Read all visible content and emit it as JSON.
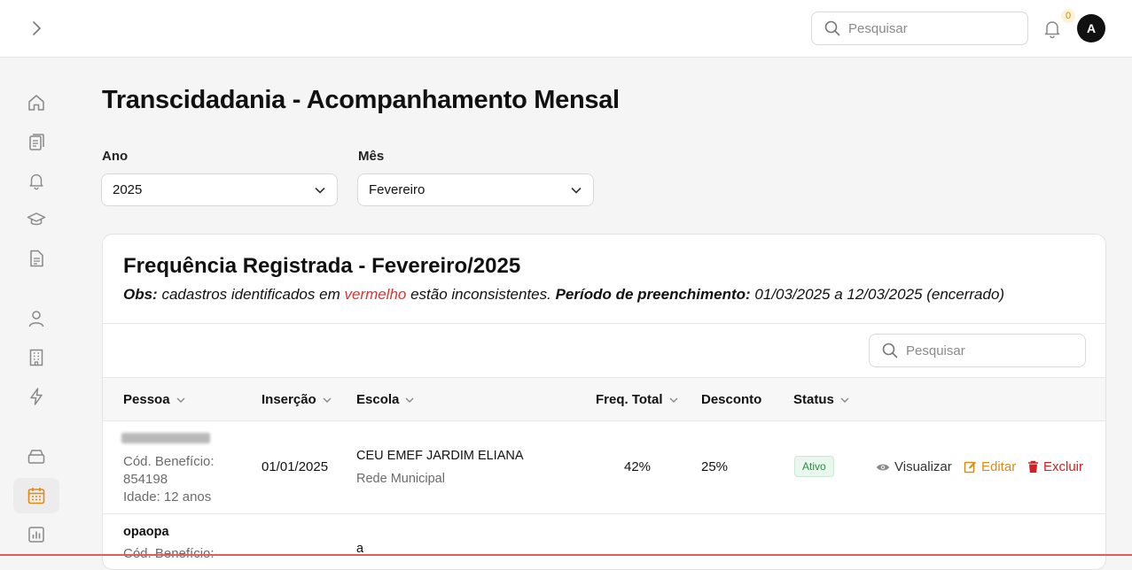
{
  "topbar": {
    "search_placeholder": "Pesquisar",
    "notification_count": "0",
    "avatar_initial": "A"
  },
  "sidebar": {
    "items": [
      {
        "icon": "home-icon"
      },
      {
        "icon": "clipboard-icon"
      },
      {
        "icon": "bell-icon"
      },
      {
        "icon": "graduation-cap-icon"
      },
      {
        "icon": "document-icon"
      },
      {
        "icon": "user-icon"
      },
      {
        "icon": "building-icon"
      },
      {
        "icon": "lightning-icon"
      },
      {
        "icon": "archive-icon"
      },
      {
        "icon": "calendar-icon",
        "active": true
      },
      {
        "icon": "bar-chart-icon"
      }
    ]
  },
  "page": {
    "title": "Transcidadania - Acompanhamento Mensal"
  },
  "filters": {
    "year_label": "Ano",
    "year_value": "2025",
    "month_label": "Mês",
    "month_value": "Fevereiro"
  },
  "card": {
    "title": "Frequência Registrada - Fevereiro/2025",
    "obs_label": "Obs:",
    "obs_text_1": " cadastros identificados em ",
    "obs_red": "vermelho",
    "obs_text_2": " estão inconsistentes. ",
    "period_label": "Período de preenchimento:",
    "period_text": " 01/03/2025 a 12/03/2025 (encerrado)",
    "search_placeholder": "Pesquisar"
  },
  "table": {
    "headers": {
      "pessoa": "Pessoa",
      "insercao": "Inserção",
      "escola": "Escola",
      "freq_total": "Freq. Total",
      "desconto": "Desconto",
      "status": "Status"
    },
    "rows": [
      {
        "beneficio_label": "Cód. Benefício:",
        "beneficio": "854198",
        "idade": "Idade: 12 anos",
        "insercao": "01/01/2025",
        "escola": "CEU EMEF JARDIM ELIANA",
        "rede": "Rede Municipal",
        "freq_total": "42%",
        "desconto": "25%",
        "status": "Ativo",
        "actions": {
          "view": "Visualizar",
          "edit": "Editar",
          "delete": "Excluir"
        }
      },
      {
        "nome": "opaopa",
        "beneficio_label": "Cód. Benefício:",
        "escola": "a"
      }
    ]
  },
  "colors": {
    "accent_orange": "#e08a16",
    "danger_red": "#d32020",
    "status_green": "#2d8a46"
  }
}
